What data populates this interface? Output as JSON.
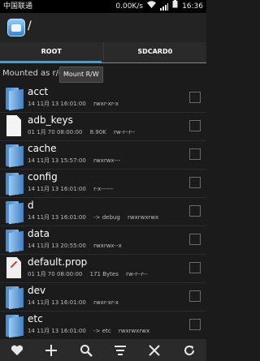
{
  "status_bar": {
    "carrier": "中国联通",
    "speed": "0.00K/s",
    "time": "16:36"
  },
  "action_bar": {
    "path": "/"
  },
  "tabs": [
    {
      "label": "ROOT",
      "active": true
    },
    {
      "label": "SDCARD0",
      "active": false
    }
  ],
  "mount": {
    "status": "Mounted as r/o",
    "button_label": "Mount R/W"
  },
  "files": [
    {
      "name": "acct",
      "type": "folder",
      "date": "14 11月 13 16:01:00",
      "size": "",
      "perms": "rwxr-xr-x"
    },
    {
      "name": "adb_keys",
      "type": "file",
      "date": "01 1月 70 08:00:00",
      "size": "8.90K",
      "perms": "rw-r--r--"
    },
    {
      "name": "cache",
      "type": "folder",
      "date": "14 11月 13 15:57:00",
      "size": "",
      "perms": "rwxrwx---"
    },
    {
      "name": "config",
      "type": "folder",
      "date": "14 11月 13 16:01:00",
      "size": "",
      "perms": "r-x------"
    },
    {
      "name": "d",
      "type": "folder",
      "date": "14 11月 13 16:01:00",
      "size": "-> debug",
      "perms": "rwxrwxrwx"
    },
    {
      "name": "data",
      "type": "folder",
      "date": "14 11月 13 20:55:00",
      "size": "",
      "perms": "rwxrwx--x"
    },
    {
      "name": "default.prop",
      "type": "prop",
      "date": "01 1月 70 08:00:00",
      "size": "171 Bytes",
      "perms": "rw-r--r--"
    },
    {
      "name": "dev",
      "type": "folder",
      "date": "14 11月 13 16:01:00",
      "size": "",
      "perms": "rwxr-xr-x"
    },
    {
      "name": "etc",
      "type": "folder",
      "date": "14 11月 13 16:01:00",
      "size": "-> etc",
      "perms": "rwxrwxrwx"
    }
  ],
  "bottom_bar": {
    "icons": [
      "heart-icon",
      "plus-icon",
      "search-icon",
      "sort-icon",
      "close-icon",
      "refresh-icon"
    ]
  },
  "colors": {
    "accent": "#33a5e5",
    "background": "#1b1b1b"
  }
}
